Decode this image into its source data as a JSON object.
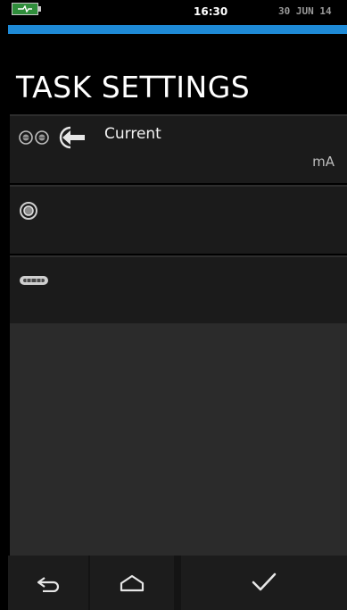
{
  "status": {
    "time": "16:30",
    "date": "30 JUN 14",
    "battery_icon": "battery-charging-icon"
  },
  "colors": {
    "accent": "#1e8ad6",
    "battery": "#2f8d3b",
    "row_bg": "#1b1b1b",
    "content_bg": "#2b2b2b"
  },
  "page": {
    "title": "TASK SETTINGS"
  },
  "rows": [
    {
      "icons": [
        "terminal-pair-icon",
        "measure-input-arrow-icon"
      ],
      "label": "Current",
      "unit": "mA"
    },
    {
      "icons": [
        "pressure-port-icon"
      ],
      "label": "",
      "unit": ""
    },
    {
      "icons": [
        "external-sensor-icon"
      ],
      "label": "",
      "unit": ""
    }
  ],
  "nav": {
    "back_icon": "back-arrow-icon",
    "home_icon": "home-icon",
    "confirm_icon": "checkmark-icon"
  }
}
